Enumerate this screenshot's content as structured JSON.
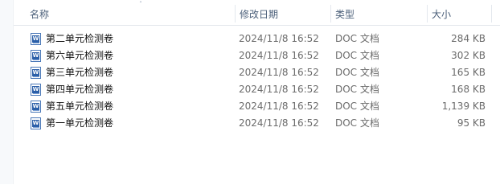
{
  "columns": {
    "name": "名称",
    "date": "修改日期",
    "type": "类型",
    "size": "大小"
  },
  "sort_indicator": "ˆ",
  "files": [
    {
      "name": "第二单元检测卷",
      "date": "2024/11/8 16:52",
      "type": "DOC 文档",
      "size": "284 KB",
      "icon": "word-doc-icon"
    },
    {
      "name": "第六单元检测卷",
      "date": "2024/11/8 16:52",
      "type": "DOC 文档",
      "size": "302 KB",
      "icon": "word-doc-icon"
    },
    {
      "name": "第三单元检测卷",
      "date": "2024/11/8 16:52",
      "type": "DOC 文档",
      "size": "165 KB",
      "icon": "word-doc-icon"
    },
    {
      "name": "第四单元检测卷",
      "date": "2024/11/8 16:52",
      "type": "DOC 文档",
      "size": "168 KB",
      "icon": "word-doc-icon"
    },
    {
      "name": "第五单元检测卷",
      "date": "2024/11/8 16:52",
      "type": "DOC 文档",
      "size": "1,139 KB",
      "icon": "word-doc-icon"
    },
    {
      "name": "第一单元检测卷",
      "date": "2024/11/8 16:52",
      "type": "DOC 文档",
      "size": "95 KB",
      "icon": "word-doc-icon"
    }
  ]
}
